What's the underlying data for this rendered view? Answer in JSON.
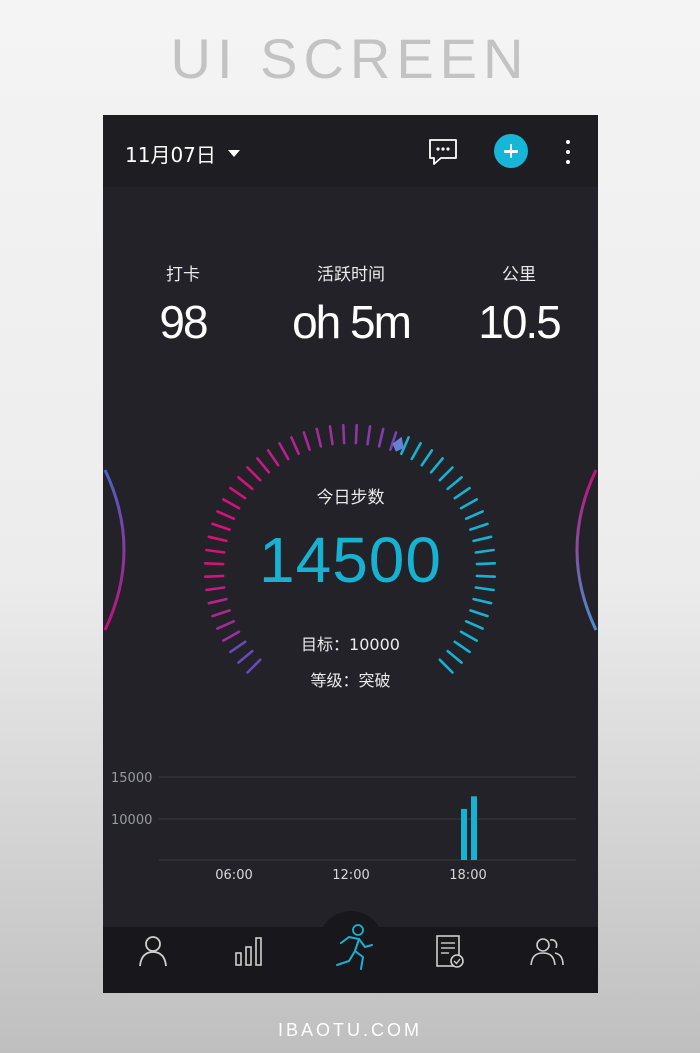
{
  "frame": {
    "title": "UI SCREEN",
    "footer": "IBAOTU.COM"
  },
  "header": {
    "date": "11月07日",
    "icons": [
      "chat-icon",
      "plus-icon",
      "more-vertical-icon"
    ],
    "accent_color": "#17b6d6"
  },
  "stats": [
    {
      "label": "打卡",
      "value": "98"
    },
    {
      "label": "活跃时间",
      "value": "oh 5m"
    },
    {
      "label": "公里",
      "value": "10.5"
    }
  ],
  "gauge": {
    "title": "今日步数",
    "steps": "14500",
    "goal_label": "目标：",
    "goal_value": "10000",
    "level_label": "等级：",
    "level_value": "突破",
    "colors": {
      "start": "#d6127a",
      "mid": "#7a42b0",
      "end": "#17b2d2",
      "inactive": "#17b2d2"
    }
  },
  "chart_data": {
    "type": "bar",
    "y_ticks": [
      "15000",
      "10000"
    ],
    "x_ticks": [
      "06:00",
      "12:00",
      "18:00"
    ],
    "bars": [
      {
        "x": 18.0,
        "value": 11200
      },
      {
        "x": 18.5,
        "value": 12700
      }
    ],
    "bar_color": "#17b2d2",
    "grid": true
  },
  "nav": {
    "items": [
      "profile-icon",
      "bar-chart-icon",
      "running-icon",
      "report-icon",
      "friends-icon"
    ],
    "active_index": 2,
    "active_color": "#17b2d2",
    "inactive_color": "#cfcfcf"
  }
}
